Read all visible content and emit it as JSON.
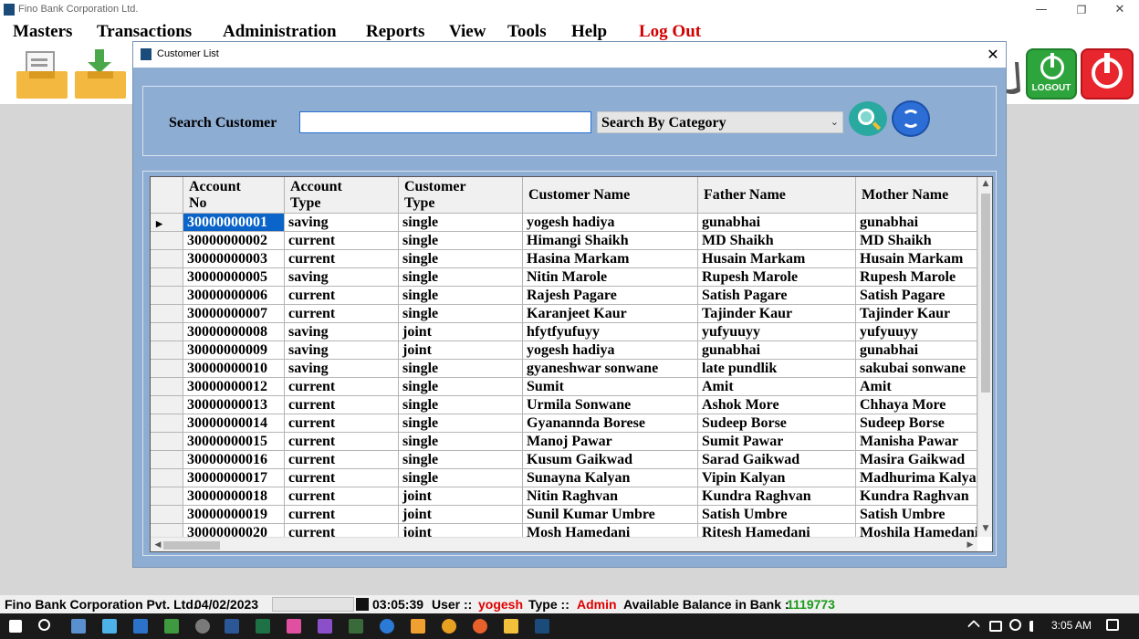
{
  "app": {
    "title": "Fino Bank Corporation Ltd."
  },
  "menu": [
    "Masters",
    "Transactions",
    "Administration",
    "Reports",
    "View",
    "Tools",
    "Help",
    "Log Out"
  ],
  "toolbar": {
    "logout_label": "LOGOUT"
  },
  "dialog": {
    "title": "Customer List",
    "search_label": "Search Customer",
    "search_value": "",
    "category_value": "Search By Category"
  },
  "grid": {
    "columns": [
      {
        "label": "Account No",
        "l1": "Account",
        "l2": "No"
      },
      {
        "label": "Account Type",
        "l1": "Account",
        "l2": "Type"
      },
      {
        "label": "Customer Type",
        "l1": "Customer",
        "l2": "Type"
      },
      {
        "label": "Customer Name",
        "l1": "Customer Name",
        "l2": ""
      },
      {
        "label": "Father Name",
        "l1": "Father Name",
        "l2": ""
      },
      {
        "label": "Mother Name",
        "l1": "Mother Name",
        "l2": ""
      }
    ],
    "rows": [
      [
        "30000000001",
        "saving",
        "single",
        "yogesh hadiya",
        "gunabhai",
        "gunabhai"
      ],
      [
        "30000000002",
        "current",
        "single",
        "Himangi Shaikh",
        "MD Shaikh",
        "MD Shaikh"
      ],
      [
        "30000000003",
        "current",
        "single",
        "Hasina Markam",
        "Husain Markam",
        "Husain Markam"
      ],
      [
        "30000000005",
        "saving",
        "single",
        "Nitin Marole",
        "Rupesh Marole",
        "Rupesh Marole"
      ],
      [
        "30000000006",
        "current",
        "single",
        "Rajesh Pagare",
        "Satish Pagare",
        "Satish Pagare"
      ],
      [
        "30000000007",
        "current",
        "single",
        "Karanjeet Kaur",
        "Tajinder Kaur",
        "Tajinder Kaur"
      ],
      [
        "30000000008",
        "saving",
        "joint",
        "hfytfyufuyy",
        "yufyuuyy",
        "yufyuuyy"
      ],
      [
        "30000000009",
        "saving",
        "joint",
        "yogesh hadiya",
        "gunabhai",
        "gunabhai"
      ],
      [
        "30000000010",
        "saving",
        "single",
        "gyaneshwar sonwane",
        "late pundlik",
        "sakubai sonwane"
      ],
      [
        "30000000012",
        "current",
        "single",
        "Sumit",
        "Amit",
        "Amit"
      ],
      [
        "30000000013",
        "current",
        "single",
        "Urmila Sonwane",
        "Ashok More",
        "Chhaya More"
      ],
      [
        "30000000014",
        "current",
        "single",
        "Gyanannda Borese",
        "Sudeep Borse",
        "Sudeep Borse"
      ],
      [
        "30000000015",
        "current",
        "single",
        "Manoj Pawar",
        "Sumit Pawar",
        "Manisha Pawar"
      ],
      [
        "30000000016",
        "current",
        "single",
        "Kusum Gaikwad",
        "Sarad Gaikwad",
        "Masira Gaikwad"
      ],
      [
        "30000000017",
        "current",
        "single",
        "Sunayna Kalyan",
        "Vipin Kalyan",
        "Madhurima Kalyan"
      ],
      [
        "30000000018",
        "current",
        "joint",
        "Nitin Raghvan",
        "Kundra Raghvan",
        "Kundra Raghvan"
      ],
      [
        "30000000019",
        "current",
        "joint",
        "Sunil Kumar Umbre",
        "Satish Umbre",
        "Satish Umbre"
      ],
      [
        "30000000020",
        "current",
        "joint",
        "Mosh Hamedani",
        "Ritesh Hamedani",
        "Moshila Hamedani"
      ]
    ]
  },
  "status": {
    "company": "Fino Bank Corporation Pvt. Ltd.",
    "date": "04/02/2023",
    "time": "03:05:39",
    "user_label": "User ::",
    "user": "yogesh",
    "type_label": "Type ::",
    "type": "Admin",
    "balance_label": "Available Balance in Bank :",
    "balance": "1119773",
    "colors": {
      "user": "#e00000",
      "type": "#e00000",
      "balance": "#1a9a1a",
      "logout_menu": "#d00000"
    }
  },
  "taskbar": {
    "time": "3:05 AM"
  }
}
